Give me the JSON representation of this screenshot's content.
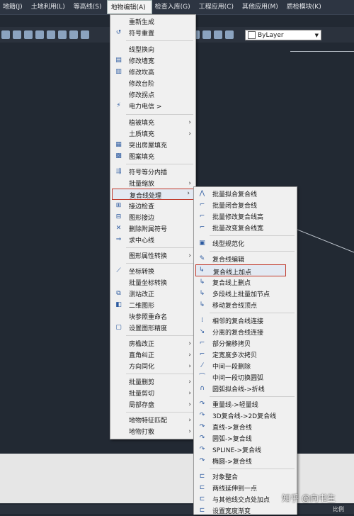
{
  "menubar": {
    "items": [
      "地籍(J)",
      "土地利用(L)",
      "等高线(S)",
      "地物编辑(A)",
      "检查入库(G)",
      "工程应用(C)",
      "其他应用(M)",
      "质检模块(K)"
    ]
  },
  "toolbar": {
    "layer_value": "ByLayer"
  },
  "menu": {
    "items": [
      "重新生成",
      "符号重置",
      "线型换向",
      "修改墙宽",
      "修改坎高",
      "修改台阶",
      "修改拐点",
      "电力电信 >",
      "植被填充",
      "土质填充",
      "突出房屋填充",
      "图案填充",
      "符号等分内插",
      "批量缩放",
      "复合线处理",
      "接边检查",
      "图形接边",
      "删除附属符号",
      "求中心线",
      "图形属性转换",
      "坐标转换",
      "批量坐标转换",
      "测站改正",
      "二维图形",
      "块参照重命名",
      "设置图形精度",
      "房檐改正",
      "直角纠正",
      "方向同化",
      "批量删剪",
      "批量剪切",
      "局部存盘",
      "地物特征匹配",
      "地物打散"
    ]
  },
  "submenu": {
    "items": [
      "批量拟合复合线",
      "批量闭合复合线",
      "批量修改复合线高",
      "批量改变复合线宽",
      "线型规范化",
      "复合线编辑",
      "复合线上加点",
      "复合线上删点",
      "多段线上批量加节点",
      "移动复合线顶点",
      "相邻的复合线连接",
      "分离的复合线连接",
      "部分偏移拷贝",
      "定宽度多次拷贝",
      "中间一段删除",
      "中间一段切换圆弧",
      "圆弧拟合线->折线",
      "重量线->轻量线",
      "3D复合线->2D复合线",
      "直线->复合线",
      "圆弧->复合线",
      "SPLINE->复合线",
      "椭圆->复合线",
      "对象整合",
      "两线延伸到一点",
      "与其他线交点处加点",
      "设置宽度渐变"
    ]
  },
  "watermark": "知乎 @向书生",
  "status_tail": "比例",
  "colors": {
    "background": "#222933",
    "menu_bg": "#f0f0f0",
    "highlight_border": "#c0392b"
  }
}
